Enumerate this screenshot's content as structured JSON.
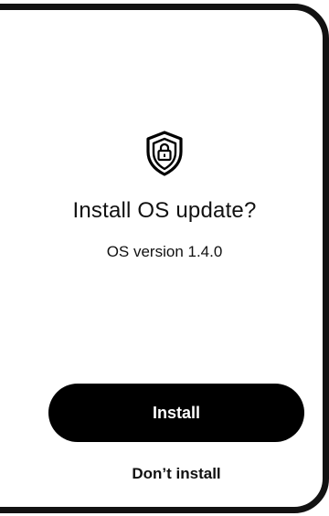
{
  "dialog": {
    "icon": "shield-lock-icon",
    "title": "Install OS update?",
    "subtitle": "OS version 1.4.0",
    "primary_label": "Install",
    "secondary_label": "Don’t install"
  },
  "colors": {
    "primary_button_bg": "#000000",
    "primary_button_text": "#ffffff",
    "text": "#111111",
    "frame": "#121212",
    "background": "#ffffff"
  }
}
